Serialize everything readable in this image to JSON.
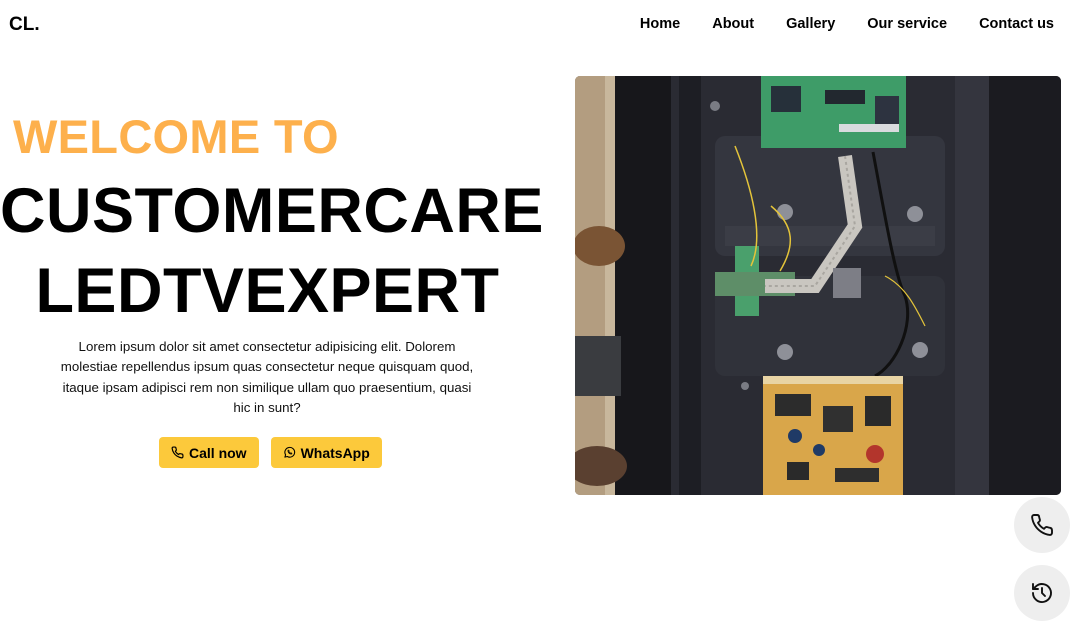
{
  "brand": "CL.",
  "nav": {
    "items": [
      "Home",
      "About",
      "Gallery",
      "Our service",
      "Contact us"
    ]
  },
  "hero": {
    "welcome": "WELCOME TO",
    "title_line1": "CUSTOMERCARE",
    "title_line2": "LEDTVEXPERT",
    "description": "Lorem ipsum dolor sit amet consectetur adipisicing elit. Dolorem molestiae repellendus ipsum quas consectetur neque quisquam quod, itaque ipsam adipisci rem non similique ullam quo praesentium, quasi hic in sunt?",
    "call_label": "Call now",
    "whatsapp_label": "WhatsApp"
  },
  "colors": {
    "accent": "#fdb04c",
    "button": "#fcc93b"
  },
  "icons": {
    "call_button": "phone-icon",
    "whatsapp_button": "whatsapp-icon",
    "fab_call": "phone-icon",
    "fab_history": "history-icon"
  }
}
